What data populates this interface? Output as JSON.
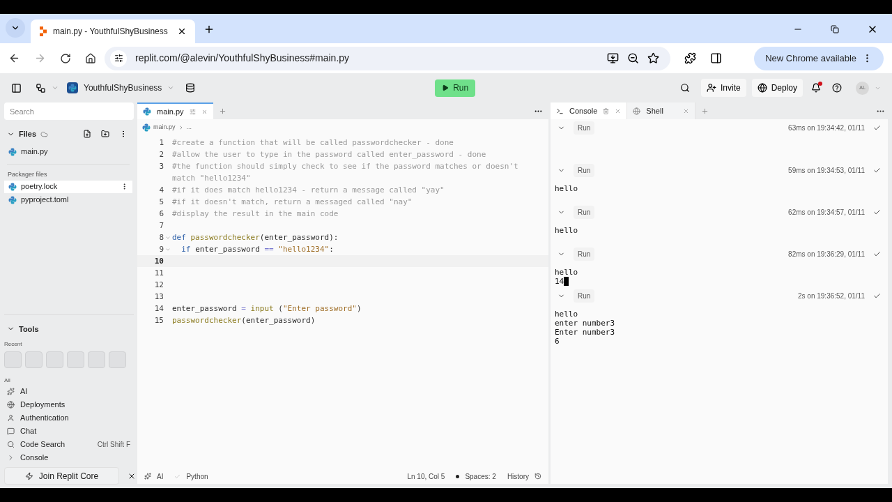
{
  "browser": {
    "tab_title": "main.py - YouthfulShyBusiness",
    "url": "replit.com/@alevin/YouthfulShyBusiness#main.py",
    "update_button": "New Chrome available"
  },
  "header": {
    "project": "YouthfulShyBusiness",
    "run_button": "Run",
    "invite": "Invite",
    "deploy": "Deploy",
    "avatar": "AL",
    "notification": true
  },
  "sidebar": {
    "search_placeholder": "Search",
    "files_title": "Files",
    "files": [
      {
        "name": "main.py",
        "highlighted": false
      }
    ],
    "packager_title": "Packager files",
    "packager_files": [
      {
        "name": "poetry.lock",
        "highlighted": true
      },
      {
        "name": "pyproject.toml",
        "highlighted": false
      }
    ],
    "tools_title": "Tools",
    "recent_label": "Recent",
    "all_label": "All",
    "tools": [
      {
        "label": "AI",
        "kind": "ai"
      },
      {
        "label": "Deployments",
        "kind": "deploy"
      },
      {
        "label": "Authentication",
        "kind": "user"
      },
      {
        "label": "Chat",
        "kind": "chat"
      },
      {
        "label": "Code Search",
        "kind": "search",
        "shortcut": "Ctrl Shift F"
      },
      {
        "label": "Console",
        "kind": "console"
      }
    ],
    "join_button": "Join Replit Core"
  },
  "editor": {
    "tab": "main.py",
    "breadcrumb": "main.py",
    "breadcrumb_more": "...",
    "lines": [
      {
        "n": "1",
        "current": false,
        "fold": false,
        "tokens": [
          {
            "kind": "comment",
            "text": "#create a function that will be called passwordchecker - done"
          }
        ]
      },
      {
        "n": "2",
        "current": false,
        "fold": false,
        "tokens": [
          {
            "kind": "comment",
            "text": "#allow the user to type in the password called enter_password - done"
          }
        ]
      },
      {
        "n": "3",
        "current": false,
        "fold": false,
        "tokens": [
          {
            "kind": "comment",
            "text": "#the function should simply check to see if the password matches or doesn't match \"hello1234\""
          }
        ]
      },
      {
        "n": "4",
        "current": false,
        "fold": false,
        "tokens": [
          {
            "kind": "comment",
            "text": "#if it does match hello1234 - return a message called \"yay\""
          }
        ]
      },
      {
        "n": "5",
        "current": false,
        "fold": false,
        "tokens": [
          {
            "kind": "comment",
            "text": "#if it doesn't match, return a messaged called \"nay\""
          }
        ]
      },
      {
        "n": "6",
        "current": false,
        "fold": false,
        "tokens": [
          {
            "kind": "comment",
            "text": "#display the result in the main code"
          }
        ]
      },
      {
        "n": "7",
        "current": false,
        "fold": false
      },
      {
        "n": "8",
        "current": false,
        "fold": true,
        "tokens": [
          {
            "kind": "keyword",
            "text": "def "
          },
          {
            "kind": "function",
            "text": "passwordchecker"
          },
          {
            "kind": "plain",
            "text": "(enter_password):"
          }
        ]
      },
      {
        "n": "9",
        "current": false,
        "fold": true,
        "tokens": [
          {
            "kind": "keyword",
            "text": "  if "
          },
          {
            "kind": "plain",
            "text": "enter_password "
          },
          {
            "kind": "operator",
            "text": "== "
          },
          {
            "kind": "string",
            "text": "\"hello1234\""
          },
          {
            "kind": "plain",
            "text": ":"
          }
        ]
      },
      {
        "n": "10",
        "current": true,
        "fold": false
      },
      {
        "n": "11",
        "current": false,
        "fold": false
      },
      {
        "n": "12",
        "current": false,
        "fold": false
      },
      {
        "n": "13",
        "current": false,
        "fold": false
      },
      {
        "n": "14",
        "current": false,
        "fold": false,
        "tokens": [
          {
            "kind": "plain",
            "text": "enter_password "
          },
          {
            "kind": "operator",
            "text": "= "
          },
          {
            "kind": "function",
            "text": "input "
          },
          {
            "kind": "plain",
            "text": "("
          },
          {
            "kind": "string",
            "text": "\"Enter password\""
          },
          {
            "kind": "plain",
            "text": ")"
          }
        ]
      },
      {
        "n": "15",
        "current": false,
        "fold": false,
        "tokens": [
          {
            "kind": "function",
            "text": "passwordchecker"
          },
          {
            "kind": "plain",
            "text": "(enter_password)"
          }
        ]
      }
    ],
    "status": {
      "ai": "AI",
      "language": "Python",
      "position": "Ln 10, Col 5",
      "spaces": "Spaces: 2",
      "history": "History"
    }
  },
  "console": {
    "tabs": [
      {
        "label": "Console",
        "kind": "console",
        "selected": true
      },
      {
        "label": "Shell",
        "kind": "shell",
        "selected": false
      }
    ],
    "runs": [
      {
        "label": "Run",
        "timing": "63ms on 19:34:42, 01/11",
        "cursor": false
      },
      {
        "label": "Run",
        "timing": "59ms on 19:34:53, 01/11",
        "output": [
          "hello"
        ],
        "cursor": false
      },
      {
        "label": "Run",
        "timing": "62ms on 19:34:57, 01/11",
        "output": [
          "hello"
        ],
        "cursor": false
      },
      {
        "label": "Run",
        "timing": "82ms on 19:36:29, 01/11",
        "output": [
          "hello",
          "14"
        ],
        "cursor": true
      },
      {
        "label": "Run",
        "timing": "2s on 19:36:52, 01/11",
        "output": [
          "hello",
          "enter number3",
          "Enter number3",
          "6"
        ],
        "cursor": false
      }
    ]
  }
}
